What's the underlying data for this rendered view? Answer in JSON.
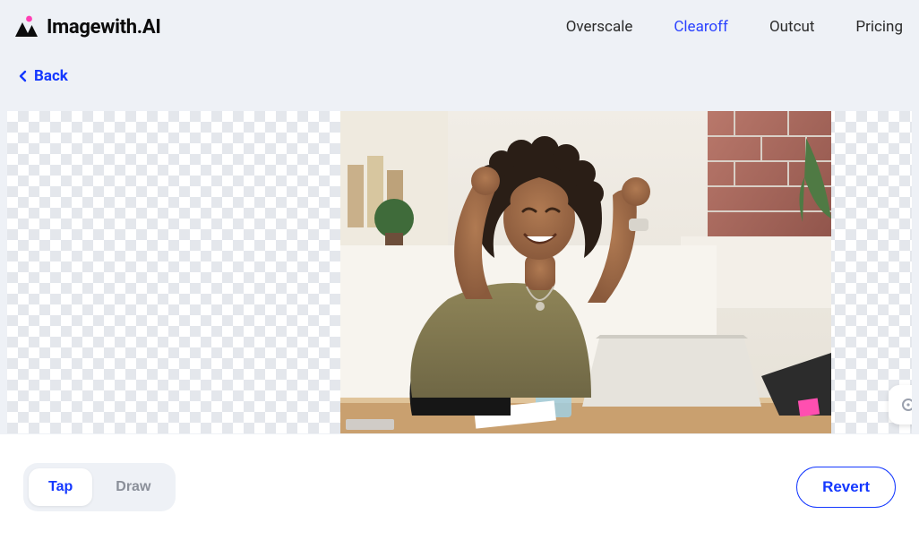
{
  "brand": "Imagewith.AI",
  "nav": {
    "overscale": "Overscale",
    "clearoff": "Clearoff",
    "outcut": "Outcut",
    "pricing": "Pricing",
    "active": "clearoff"
  },
  "back": "Back",
  "tools": {
    "tap": "Tap",
    "draw": "Draw",
    "active": "tap"
  },
  "revert": "Revert"
}
